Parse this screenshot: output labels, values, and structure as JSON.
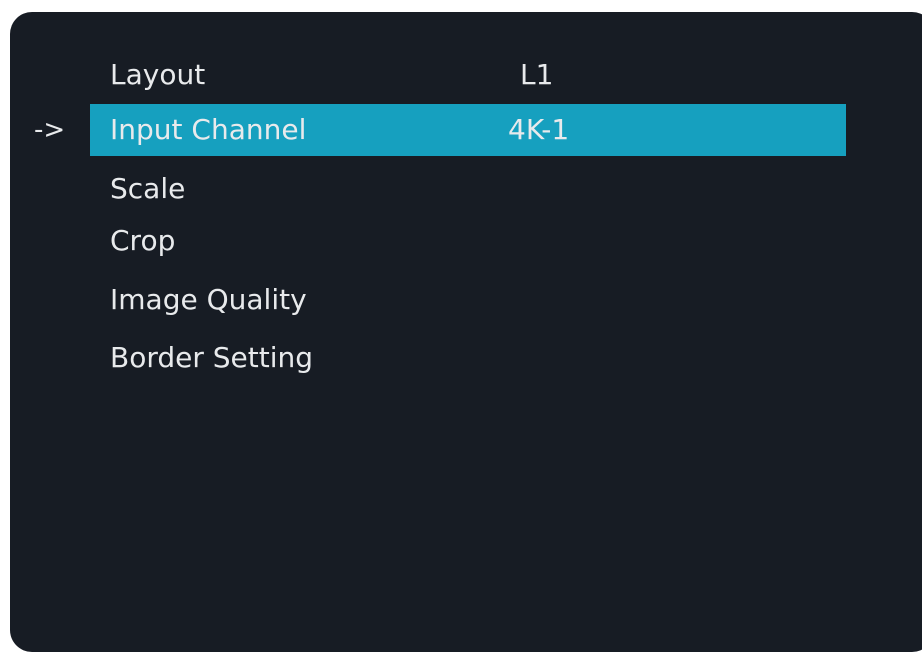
{
  "menu": {
    "cursor": "->",
    "items": [
      {
        "label": "Layout",
        "value": "L1"
      },
      {
        "label": "Input Channel",
        "value": "4K-1"
      },
      {
        "label": "Scale",
        "value": ""
      },
      {
        "label": "Crop",
        "value": ""
      },
      {
        "label": "Image Quality",
        "value": ""
      },
      {
        "label": "Border Setting",
        "value": ""
      }
    ],
    "selected_index": 1
  },
  "colors": {
    "panel_background": "#171c24",
    "selection_highlight": "#16a0bf",
    "text": "#e8eaec"
  }
}
